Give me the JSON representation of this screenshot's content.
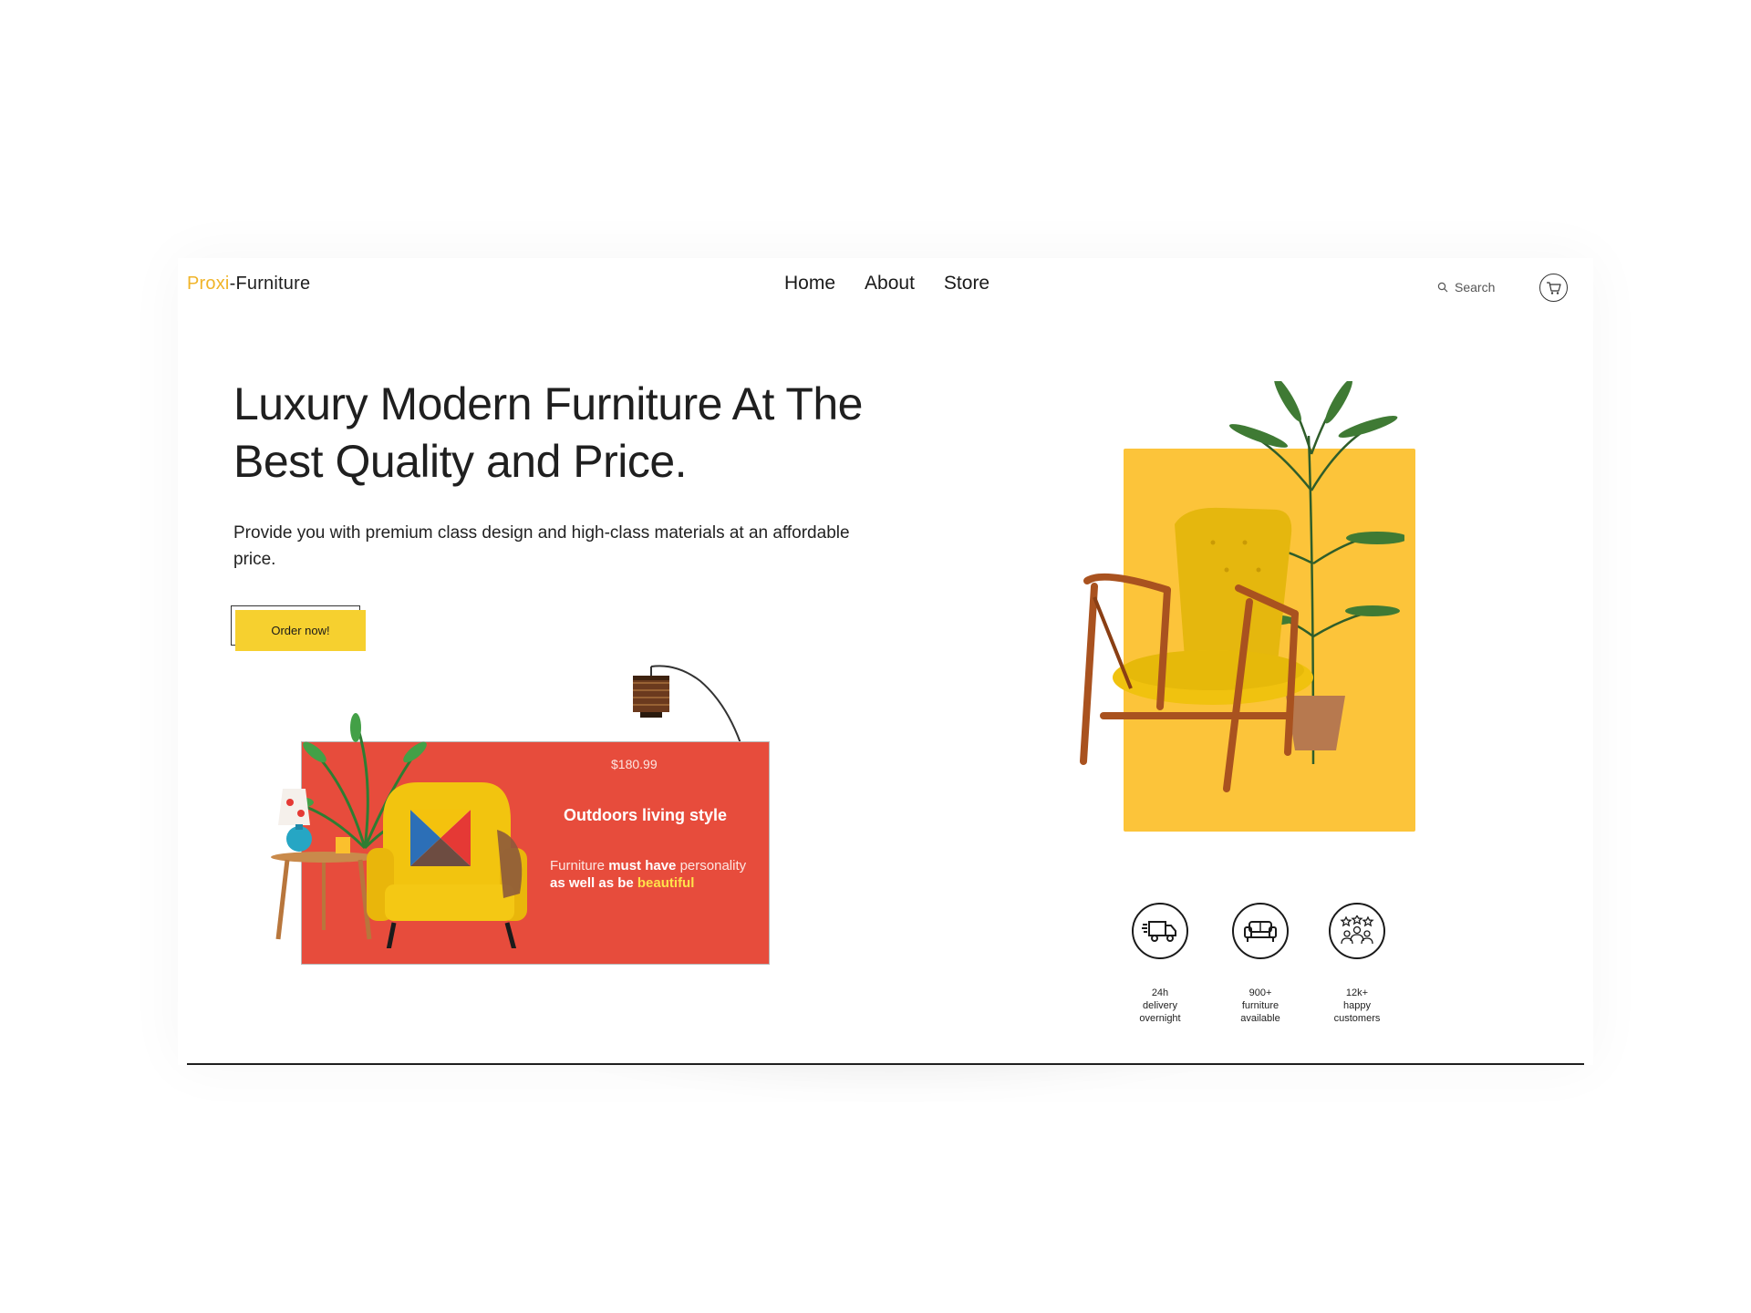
{
  "brand": {
    "part1": "Proxi",
    "dash": "-",
    "part2": "Furniture"
  },
  "nav": {
    "items": [
      "Home",
      "About",
      "Store"
    ]
  },
  "search": {
    "label": "Search"
  },
  "hero": {
    "headline": "Luxury Modern Furniture At The Best Quality and Price.",
    "subtext": "Provide you with premium class design and high-class materials at an affordable price.",
    "cta": "Order now!"
  },
  "promo": {
    "price": "$180.99",
    "title": "Outdoors living style",
    "text_1": "Furniture ",
    "text_bold_1": "must have",
    "text_2": " personality",
    "text_bold_2": "as well as be ",
    "text_highlight": "beautiful"
  },
  "features": [
    {
      "icon": "delivery-truck-icon",
      "label": "24h\ndelivery\novernight"
    },
    {
      "icon": "sofa-icon",
      "label": "900+\nfurniture\navailable"
    },
    {
      "icon": "happy-customers-icon",
      "label": "12k+\nhappy\ncustomers"
    }
  ],
  "colors": {
    "accent_yellow": "#f6d02f",
    "panel_yellow": "#fcc43a",
    "promo_red": "#e74c3c",
    "logo_yellow": "#f0b429"
  }
}
